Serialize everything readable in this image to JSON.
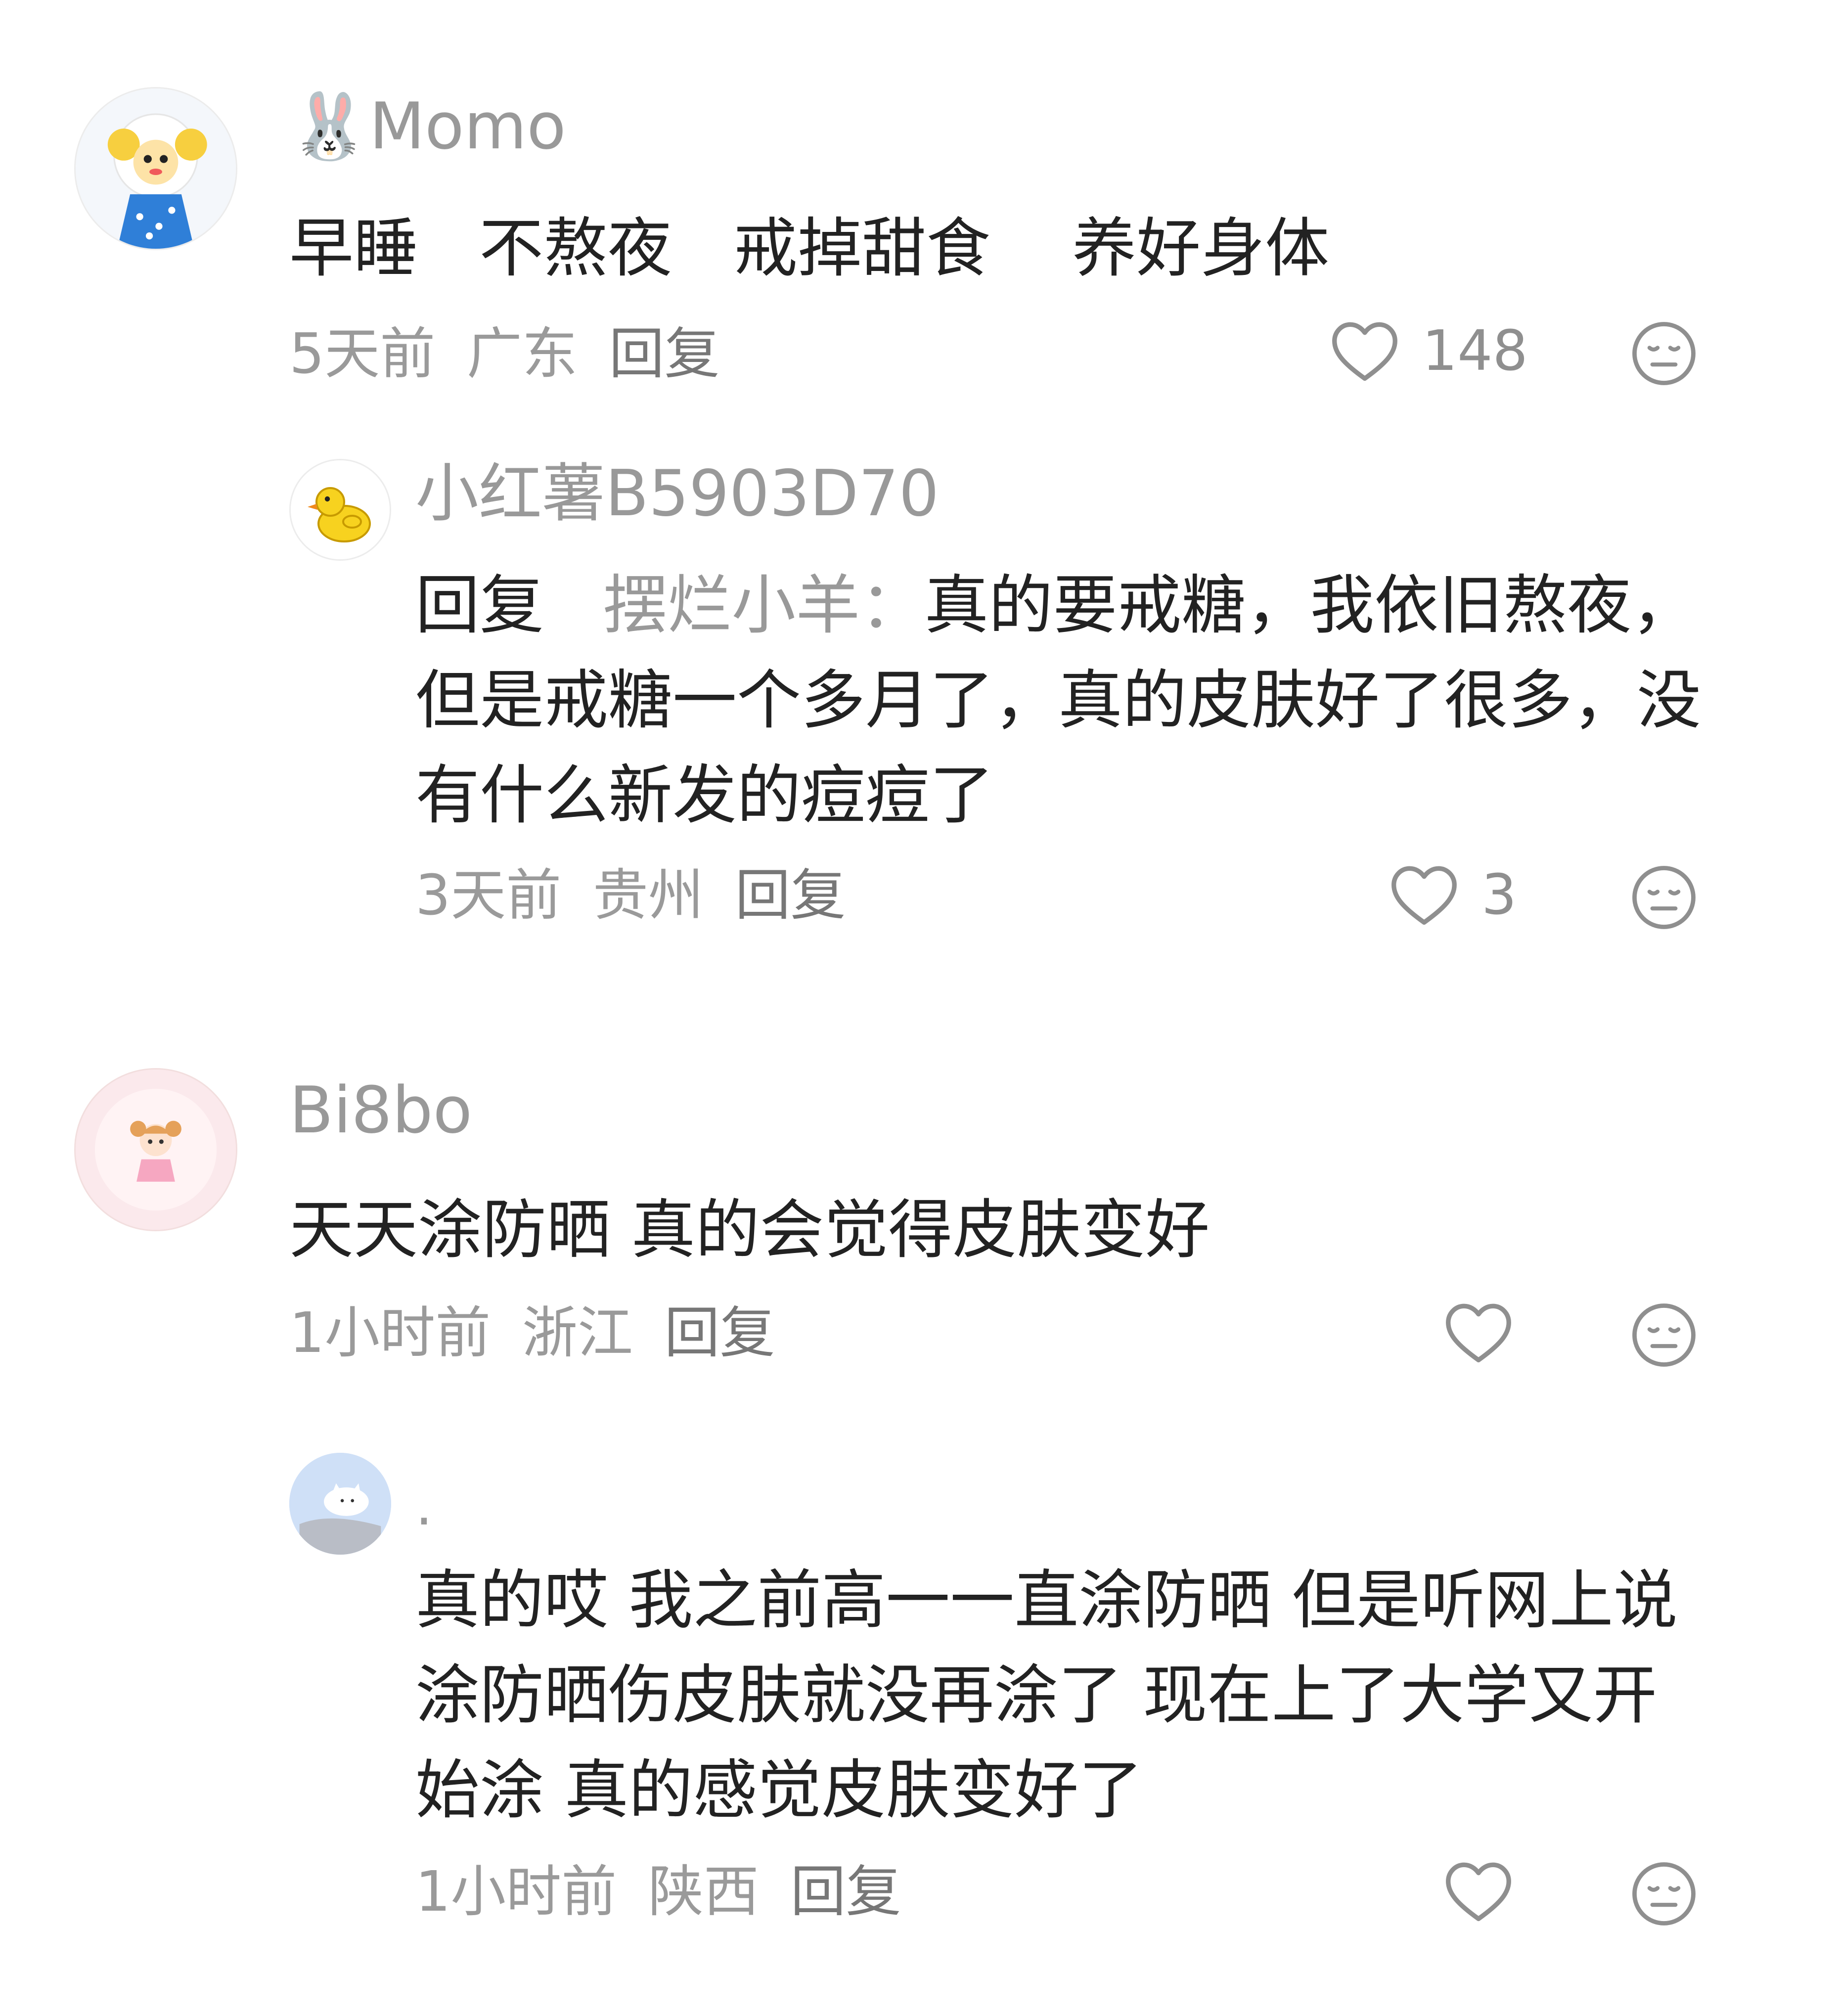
{
  "comments": [
    {
      "author": "🐰Momo",
      "text": "早睡   不熬夜   戒掉甜食    养好身体",
      "time": "5天前",
      "location": "广东",
      "reply_label": "回复",
      "likes": "148",
      "avatar_icon": "sheep-doll-avatar",
      "replies": [
        {
          "author": "小红薯B5903D70",
          "reply_prefix": "回复",
          "mention": "摆烂小羊：",
          "text": "真的要戒糖，我依旧熬夜，但是戒糖一个多月了，真的皮肤好了很多，没有什么新发的痘痘了",
          "time": "3天前",
          "location": "贵州",
          "reply_label": "回复",
          "likes": "3",
          "avatar_icon": "duck-avatar"
        }
      ]
    },
    {
      "author": "Bi8bo",
      "text": "天天涂防晒 真的会觉得皮肤变好",
      "time": "1小时前",
      "location": "浙江",
      "reply_label": "回复",
      "likes": "",
      "avatar_icon": "girl-cartoon-avatar",
      "replies": [
        {
          "author": ".",
          "text": "真的哎 我之前高一一直涂防晒 但是听网上说涂防晒伤皮肤就没再涂了 现在上了大学又开始涂 真的感觉皮肤变好了",
          "time": "1小时前",
          "location": "陕西",
          "reply_label": "回复",
          "likes": "",
          "avatar_icon": "cat-avatar"
        }
      ]
    }
  ],
  "colors": {
    "text": "#222222",
    "muted": "#999999",
    "icon": "#8f8f8f"
  }
}
